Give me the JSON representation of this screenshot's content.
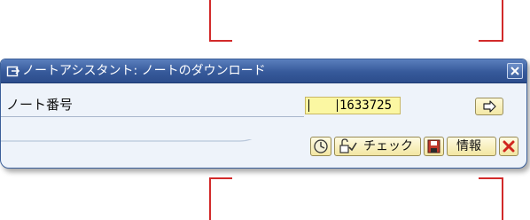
{
  "dialog": {
    "title": "ノートアシスタント: ノートのダウンロード",
    "note_number_label": "ノート番号",
    "note_number_value": "1633725"
  },
  "toolbar": {
    "check_label": "チェック",
    "info_label": "情報"
  },
  "icons": {
    "title": "dialog-window-icon",
    "close": "close-icon",
    "continue": "arrow-right-icon",
    "clock": "clock-icon",
    "check": "check-icon",
    "save": "save-icon",
    "cancel": "cancel-icon"
  },
  "colors": {
    "title_bar": "#36599a",
    "dialog_bg": "#eef3fa",
    "input_bg": "#fbf7a2",
    "button_bg": "#f6eeb9",
    "cancel_red": "#d0261f",
    "background_frame": "#d22a2a"
  }
}
